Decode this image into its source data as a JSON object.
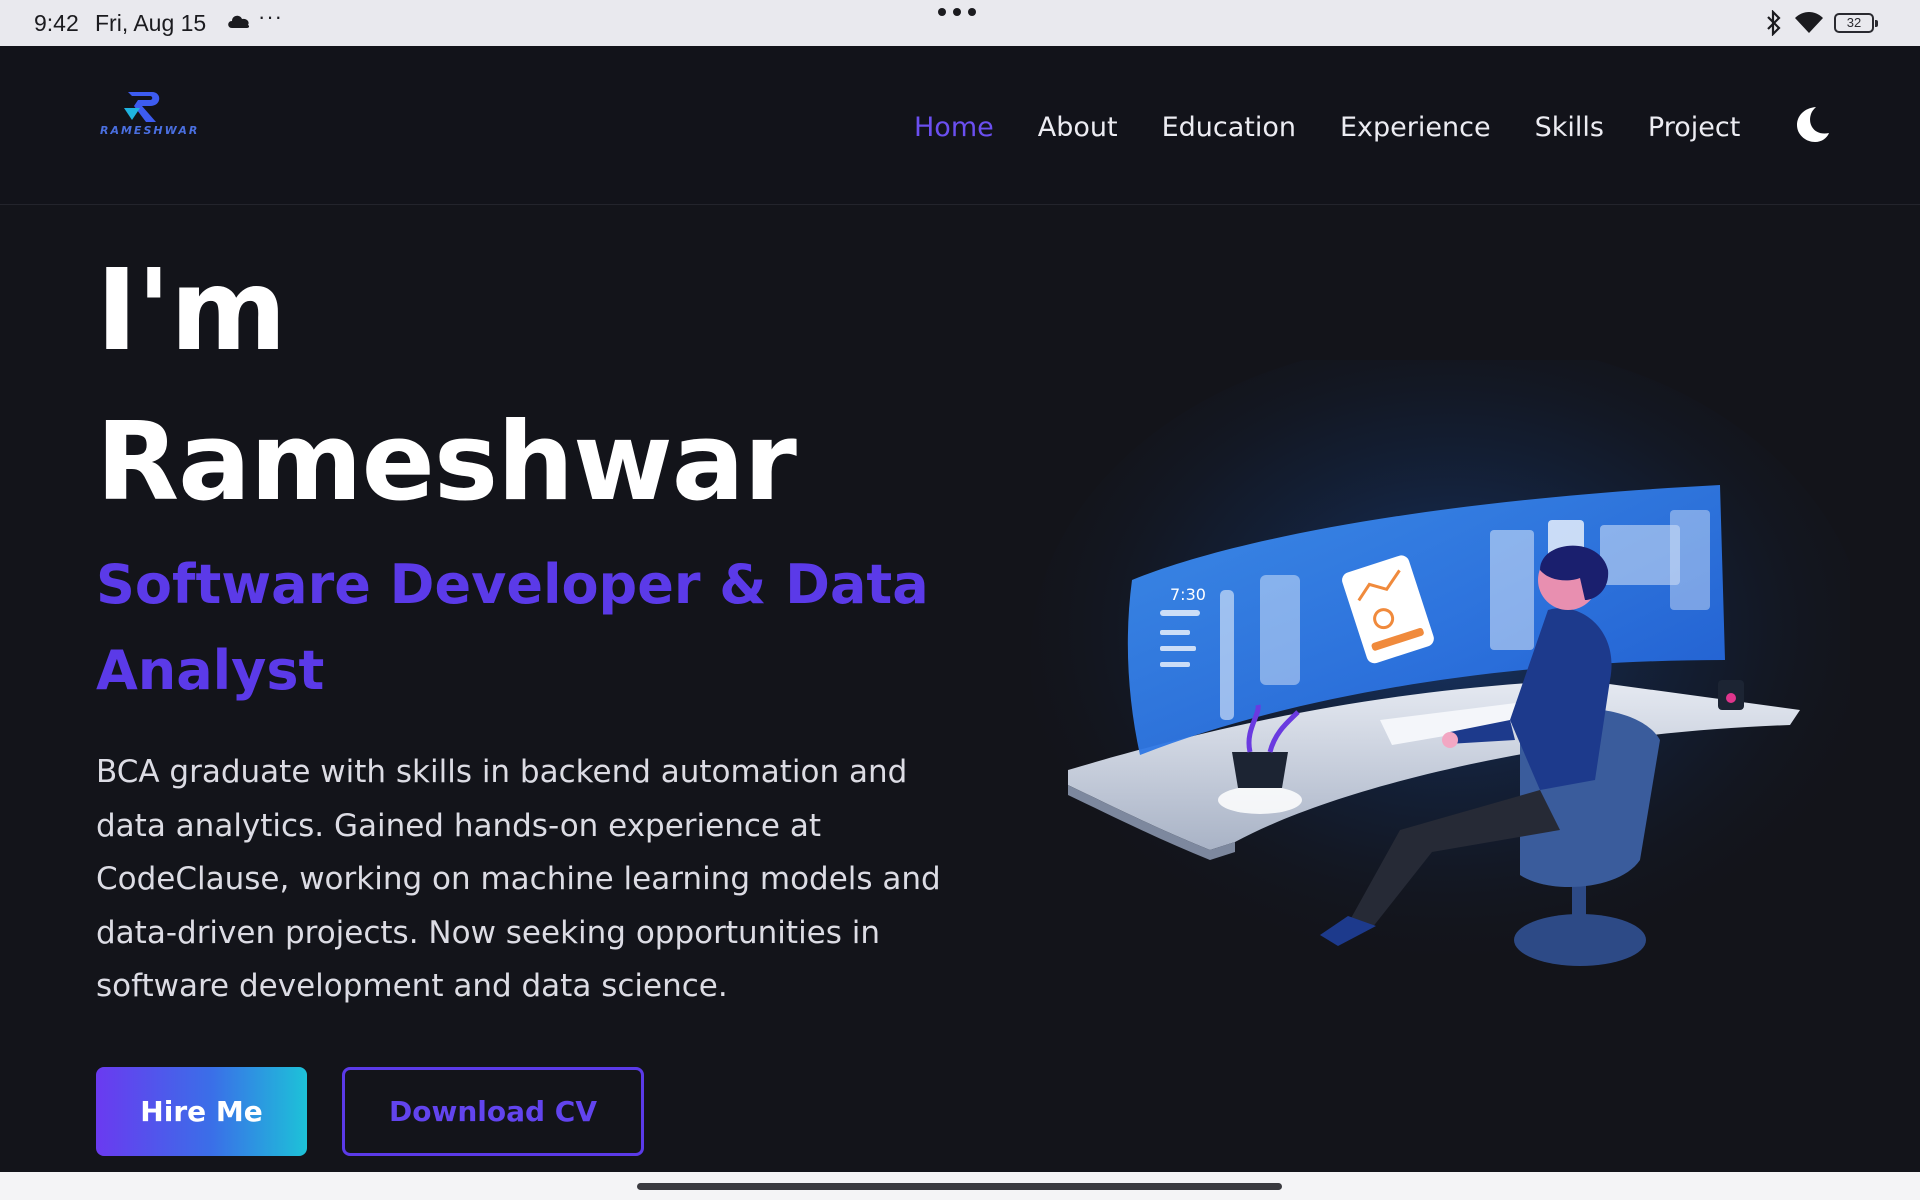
{
  "status_bar": {
    "time": "9:42",
    "date": "Fri, Aug 15",
    "more": "···",
    "battery": "32"
  },
  "header": {
    "logo_text": "RAMESHWAR",
    "nav": [
      {
        "label": "Home",
        "active": true
      },
      {
        "label": "About",
        "active": false
      },
      {
        "label": "Education",
        "active": false
      },
      {
        "label": "Experience",
        "active": false
      },
      {
        "label": "Skills",
        "active": false
      },
      {
        "label": "Project",
        "active": false
      }
    ],
    "theme_toggle_icon": "moon-icon"
  },
  "hero": {
    "greeting": "I'm",
    "name": "Rameshwar",
    "role": "Software Developer & Data Analyst",
    "description": "BCA graduate with skills in backend automation and data analytics. Gained hands-on experience at CodeClause, working on machine learning models and data-driven projects. Now seeking opportunities in software development and data science.",
    "hire_button": "Hire Me",
    "cv_button": "Download CV",
    "illustration_clock": "7:30"
  },
  "colors": {
    "accent": "#5b3ae8",
    "background": "#13141a",
    "gradient_end": "#1dc2d8"
  }
}
